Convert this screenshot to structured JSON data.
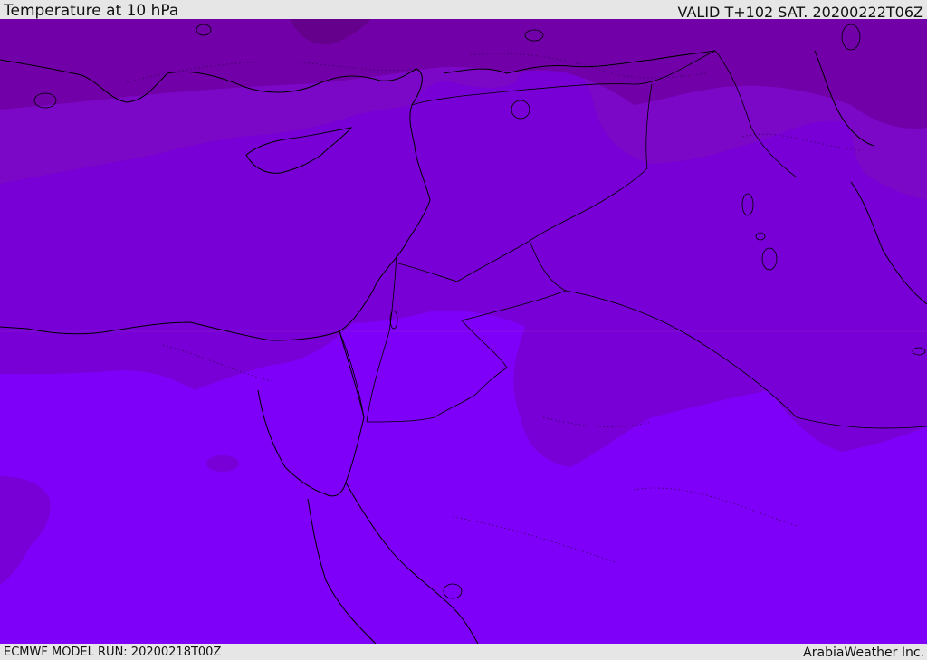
{
  "header": {
    "title": "Temperature at 10 hPa",
    "valid_time": "VALID T+102 SAT. 20200222T06Z"
  },
  "footer": {
    "model_run": "ECMWF MODEL RUN: 20200218T00Z",
    "credit": "ArabiaWeather Inc."
  },
  "colors": {
    "band_cold": "#6f0099",
    "band_cool": "#7400bd",
    "band_mid": "#7b00da",
    "band_warm": "#7f00f9",
    "coast": "#000000"
  }
}
